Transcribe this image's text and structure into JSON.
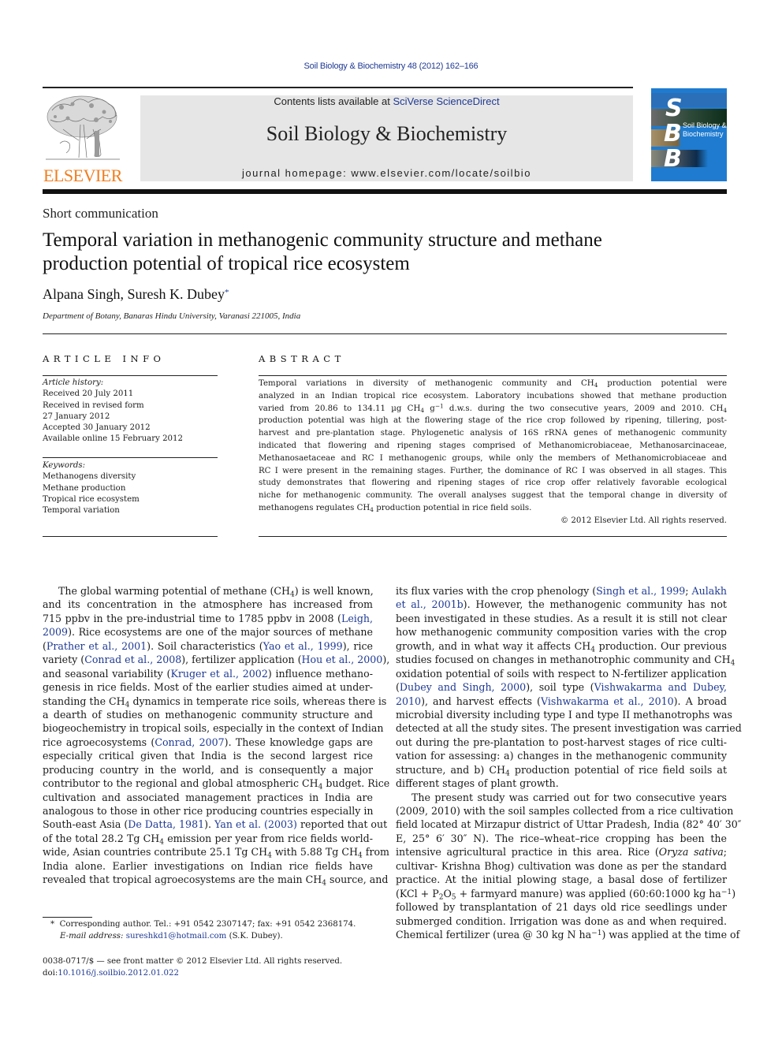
{
  "header": {
    "citation": "Soil Biology & Biochemistry 48 (2012) 162–166",
    "contents_prefix": "Contents lists available at ",
    "contents_link": "SciVerse ScienceDirect",
    "journal_title": "Soil Biology & Biochemistry",
    "homepage": "journal homepage: www.elsevier.com/locate/soilbio",
    "publisher_logo_text": "ELSEVIER",
    "cover": {
      "letters": [
        "S",
        "B",
        "B"
      ],
      "title_line1": "Soil Biology &",
      "title_line2": "Biochemistry"
    },
    "colors": {
      "link": "#1f3a93",
      "elsevier_orange": "#f07d1e",
      "cover_blue": "#1e7bd0",
      "banner_gray": "#e6e6e6"
    }
  },
  "article": {
    "type": "Short communication",
    "title_line1": "Temporal variation in methanogenic community structure and methane",
    "title_line2": "production potential of tropical rice ecosystem",
    "authors": "Alpana Singh, Suresh K. Dubey",
    "author_mark": "*",
    "affiliation": "Department of Botany, Banaras Hindu University, Varanasi 221005, India"
  },
  "article_info": {
    "heading": "ARTICLE INFO",
    "history_label": "Article history:",
    "history": [
      "Received 20 July 2011",
      "Received in revised form",
      "27 January 2012",
      "Accepted 30 January 2012",
      "Available online 15 February 2012"
    ],
    "keywords_label": "Keywords:",
    "keywords": [
      "Methanogens diversity",
      "Methane production",
      "Tropical rice ecosystem",
      "Temporal variation"
    ]
  },
  "abstract": {
    "heading": "ABSTRACT",
    "lines": [
      [
        {
          "t": "Temporal variations in diversity of methanogenic community and CH"
        },
        {
          "sub": "4"
        },
        {
          "t": " production potential were"
        }
      ],
      [
        {
          "t": "analyzed in an Indian tropical rice ecosystem. Laboratory incubations showed that methane production"
        }
      ],
      [
        {
          "t": "varied from 20.86 to 134.11 µg CH"
        },
        {
          "sub": "4"
        },
        {
          "t": " g"
        },
        {
          "sup": "−1"
        },
        {
          "t": " d.w.s. during the two consecutive years, 2009 and 2010. CH"
        },
        {
          "sub": "4"
        }
      ],
      [
        {
          "t": "production potential was high at the flowering stage of the rice crop followed by ripening, tillering, post-"
        }
      ],
      [
        {
          "t": "harvest and pre-plantation stage. Phylogenetic analysis of 16S rRNA genes of methanogenic community"
        }
      ],
      [
        {
          "t": "indicated that flowering and ripening stages comprised of Methanomicrobiaceae, Methanosarcinaceae,"
        }
      ],
      [
        {
          "t": "Methanosaetaceae and RC I methanogenic groups, while only the members of Methanomicrobiaceae and"
        }
      ],
      [
        {
          "t": "RC I were present in the remaining stages. Further, the dominance of RC I was observed in all stages. This"
        }
      ],
      [
        {
          "t": "study demonstrates that flowering and ripening stages of rice crop offer relatively favorable ecological"
        }
      ],
      [
        {
          "t": "niche for methanogenic community. The overall analyses suggest that the temporal change in diversity of"
        }
      ],
      [
        {
          "t": "methanogens regulates CH"
        },
        {
          "sub": "4"
        },
        {
          "t": " production potential in rice field soils."
        }
      ]
    ],
    "copyright": "© 2012 Elsevier Ltd. All rights reserved."
  },
  "body": {
    "left": [
      [
        {
          "t": "The global warming potential of methane (CH"
        },
        {
          "sub": "4"
        },
        {
          "t": ") is well known,"
        }
      ],
      [
        {
          "t": "and its concentration in the atmosphere has increased from"
        }
      ],
      [
        {
          "t": "715 ppbv in the pre-industrial time to 1785 ppbv in 2008 ("
        },
        {
          "a": "Leigh,"
        }
      ],
      [
        {
          "a": "2009"
        },
        {
          "t": "). Rice ecosystems are one of the major sources of methane"
        }
      ],
      [
        {
          "t": "("
        },
        {
          "a": "Prather et al., 2001"
        },
        {
          "t": "). Soil characteristics ("
        },
        {
          "a": "Yao et al., 1999"
        },
        {
          "t": "), rice"
        }
      ],
      [
        {
          "t": "variety ("
        },
        {
          "a": "Conrad et al., 2008"
        },
        {
          "t": "), fertilizer application ("
        },
        {
          "a": "Hou et al., 2000"
        },
        {
          "t": "),"
        }
      ],
      [
        {
          "t": "and seasonal variability ("
        },
        {
          "a": "Kruger et al., 2002"
        },
        {
          "t": ") influence methano-"
        }
      ],
      [
        {
          "t": "genesis in rice fields. Most of the earlier studies aimed at under-"
        }
      ],
      [
        {
          "t": "standing the CH"
        },
        {
          "sub": "4"
        },
        {
          "t": " dynamics in temperate rice soils, whereas there is"
        }
      ],
      [
        {
          "t": "a dearth of studies on methanogenic community structure and"
        }
      ],
      [
        {
          "t": "biogeochemistry in tropical soils, especially in the context of Indian"
        }
      ],
      [
        {
          "t": "rice agroecosystems ("
        },
        {
          "a": "Conrad, 2007"
        },
        {
          "t": "). These knowledge gaps are"
        }
      ],
      [
        {
          "t": "especially critical given that India is the second largest rice"
        }
      ],
      [
        {
          "t": "producing country in the world, and is consequently a major"
        }
      ],
      [
        {
          "t": "contributor to the regional and global atmospheric CH"
        },
        {
          "sub": "4"
        },
        {
          "t": " budget. Rice"
        }
      ],
      [
        {
          "t": "cultivation and associated management practices in India are"
        }
      ],
      [
        {
          "t": "analogous to those in other rice producing countries especially in"
        }
      ],
      [
        {
          "t": "South-east Asia ("
        },
        {
          "a": "De Datta, 1981"
        },
        {
          "t": "). "
        },
        {
          "a": "Yan et al. (2003)"
        },
        {
          "t": " reported that out"
        }
      ],
      [
        {
          "t": "of the total 28.2 Tg CH"
        },
        {
          "sub": "4"
        },
        {
          "t": " emission per year from rice fields world-"
        }
      ],
      [
        {
          "t": "wide, Asian countries contribute 25.1 Tg CH"
        },
        {
          "sub": "4"
        },
        {
          "t": " with 5.88 Tg CH"
        },
        {
          "sub": "4"
        },
        {
          "t": " from"
        }
      ],
      [
        {
          "t": "India alone. Earlier investigations on Indian rice fields have"
        }
      ],
      [
        {
          "t": "revealed that tropical agroecosystems are the main CH"
        },
        {
          "sub": "4"
        },
        {
          "t": " source, and"
        }
      ]
    ],
    "right": [
      [
        {
          "t": "its flux varies with the crop phenology ("
        },
        {
          "a": "Singh et al., 1999"
        },
        {
          "t": "; "
        },
        {
          "a": "Aulakh"
        }
      ],
      [
        {
          "a": "et al., 2001b"
        },
        {
          "t": "). However, the methanogenic community has not"
        }
      ],
      [
        {
          "t": "been investigated in these studies. As a result it is still not clear"
        }
      ],
      [
        {
          "t": "how methanogenic community composition varies with the crop"
        }
      ],
      [
        {
          "t": "growth, and in what way it affects CH"
        },
        {
          "sub": "4"
        },
        {
          "t": " production. Our previous"
        }
      ],
      [
        {
          "t": "studies focused on changes in methanotrophic community and CH"
        },
        {
          "sub": "4"
        }
      ],
      [
        {
          "t": "oxidation potential of soils with respect to N-fertilizer application"
        }
      ],
      [
        {
          "t": "("
        },
        {
          "a": "Dubey and Singh, 2000"
        },
        {
          "t": "), soil type ("
        },
        {
          "a": "Vishwakarma and Dubey,"
        }
      ],
      [
        {
          "a": "2010"
        },
        {
          "t": "), and harvest effects ("
        },
        {
          "a": "Vishwakarma et al., 2010"
        },
        {
          "t": "). A broad"
        }
      ],
      [
        {
          "t": "microbial diversity including type I and type II methanotrophs was"
        }
      ],
      [
        {
          "t": "detected at all the study sites. The present investigation was carried"
        }
      ],
      [
        {
          "t": "out during the pre-plantation to post-harvest stages of rice culti-"
        }
      ],
      [
        {
          "t": "vation for assessing: a) changes in the methanogenic community"
        }
      ],
      [
        {
          "t": "structure, and b) CH"
        },
        {
          "sub": "4"
        },
        {
          "t": " production potential of rice field soils at"
        }
      ],
      [
        {
          "t": "different stages of plant growth."
        },
        {
          "end": true
        }
      ],
      [
        {
          "t": "The present study was carried out for two consecutive years"
        },
        {
          "indent": true
        }
      ],
      [
        {
          "t": "(2009, 2010) with the soil samples collected from a rice cultivation"
        }
      ],
      [
        {
          "t": "field located at Mirzapur district of Uttar Pradesh, India (82° 40′ 30″"
        }
      ],
      [
        {
          "t": "E, 25° 6′ 30″ N). The rice–wheat–rice cropping has been the"
        }
      ],
      [
        {
          "t": "intensive agricultural practice in this area. Rice ("
        },
        {
          "i": "Oryza sativa"
        },
        {
          "t": ";"
        }
      ],
      [
        {
          "t": "cultivar- Krishna Bhog) cultivation was done as per the standard"
        }
      ],
      [
        {
          "t": "practice. At the initial plowing stage, a basal dose of fertilizer"
        }
      ],
      [
        {
          "t": "(KCl + P"
        },
        {
          "sub": "2"
        },
        {
          "t": "O"
        },
        {
          "sub": "5"
        },
        {
          "t": " + farmyard manure) was applied (60:60:1000 kg ha"
        },
        {
          "sup": "−1"
        },
        {
          "t": ")"
        }
      ],
      [
        {
          "t": "followed by transplantation of 21 days old rice seedlings under"
        }
      ],
      [
        {
          "t": "submerged condition. Irrigation was done as and when required."
        }
      ],
      [
        {
          "t": "Chemical fertilizer (urea @ 30 kg N ha"
        },
        {
          "sup": "−1"
        },
        {
          "t": ") was applied at the time of"
        }
      ]
    ]
  },
  "footnote": {
    "mark": "*",
    "corresponding": "Corresponding author. Tel.: +91 0542 2307147; fax: +91 0542 2368174.",
    "email_label": "E-mail address:",
    "email": "sureshkd1@hotmail.com",
    "email_suffix": "(S.K. Dubey)."
  },
  "front_matter": {
    "issn_line": "0038-0717/$ — see front matter © 2012 Elsevier Ltd. All rights reserved.",
    "doi_prefix": "doi:",
    "doi": "10.1016/j.soilbio.2012.01.022"
  }
}
